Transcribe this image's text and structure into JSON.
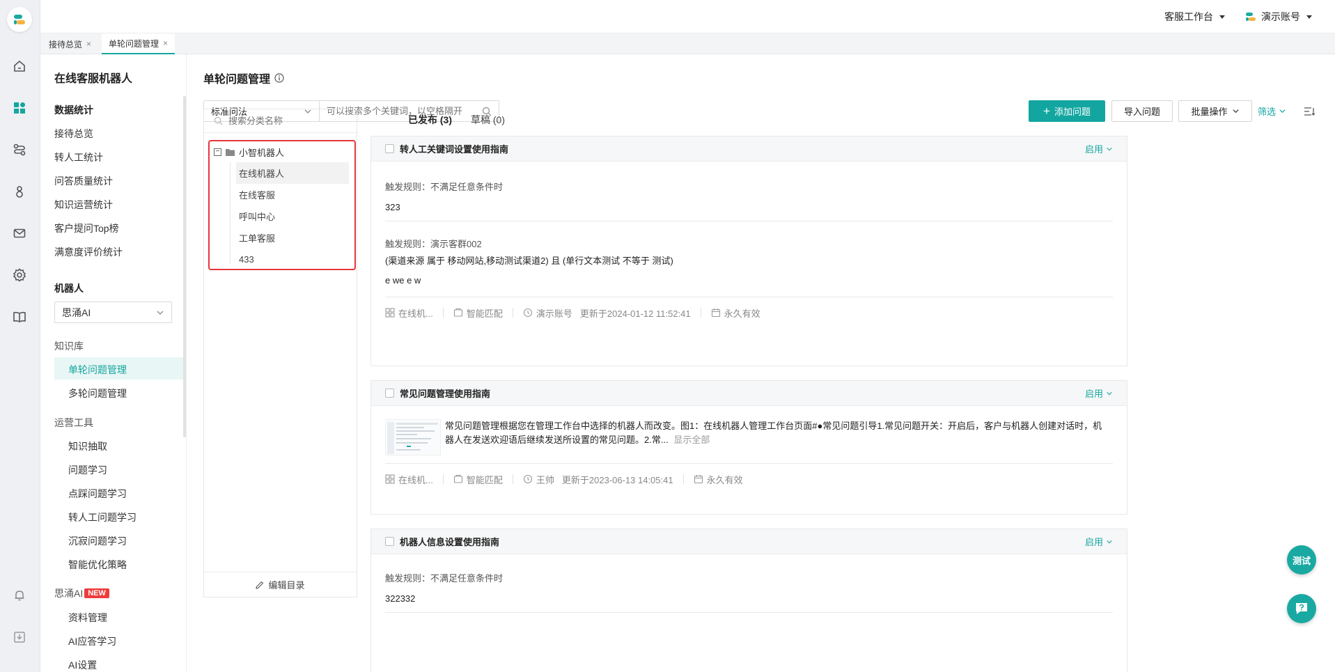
{
  "topbar": {
    "workspace": "客服工作台",
    "account": "演示账号"
  },
  "tabs": [
    {
      "label": "接待总览",
      "close": "×"
    },
    {
      "label": "单轮问题管理",
      "close": "×"
    }
  ],
  "nav": {
    "title": "在线客服机器人",
    "stats_heading": "数据统计",
    "stats_items": [
      "接待总览",
      "转人工统计",
      "问答质量统计",
      "知识运营统计",
      "客户提问Top榜",
      "满意度评价统计"
    ],
    "robot_heading": "机器人",
    "robot_select": "思涌AI",
    "kb_group": "知识库",
    "kb_items": [
      "单轮问题管理",
      "多轮问题管理"
    ],
    "ops_group": "运营工具",
    "ops_items": [
      "知识抽取",
      "问题学习",
      "点踩问题学习",
      "转人工问题学习",
      "沉寂问题学习",
      "智能优化策略"
    ],
    "ai_group": "思涌AI",
    "ai_badge": "NEW",
    "ai_items": [
      "资料管理",
      "AI应答学习",
      "AI设置"
    ]
  },
  "main": {
    "title": "单轮问题管理",
    "filter_select": "标准问法",
    "search_placeholder": "可以搜索多个关键词，以空格隔开",
    "buttons": {
      "add": "添加问题",
      "import": "导入问题",
      "batch": "批量操作",
      "filter": "筛选"
    },
    "category": {
      "search_placeholder": "搜索分类名称",
      "root": "小智机器人",
      "toggle": "−",
      "children": [
        "在线机器人",
        "在线客服",
        "呼叫中心",
        "工单客服",
        "433"
      ],
      "footer": "编辑目录"
    },
    "status_tabs": [
      "已发布 (3)",
      "草稿 (0)"
    ],
    "questions": [
      {
        "title": "转人工关键词设置使用指南",
        "status": "启用",
        "rule1_label": "触发规则：不满足任意条件时",
        "rule1_answer": "323",
        "rule2_label": "触发规则：演示客群002",
        "rule2_condition": "(渠道来源 属于 移动网站,移动测试渠道2) 且 (单行文本测试 不等于 测试)",
        "rule2_answer": "e we e w",
        "meta": {
          "channel": "在线机...",
          "match": "智能匹配",
          "author": "演示账号",
          "updated": "更新于2024-01-12 11:52:41",
          "validity": "永久有效"
        }
      },
      {
        "title": "常见问题管理使用指南",
        "status": "启用",
        "content": "常见问题管理根据您在管理工作台中选择的机器人而改变。图1：在线机器人管理工作台页面#●常见问题引导1.常见问题开关：开启后，客户与机器人创建对话时，机器人在发送欢迎语后继续发送所设置的常见问题。2.常...",
        "show_all": "显示全部",
        "meta": {
          "channel": "在线机...",
          "match": "智能匹配",
          "author": "王帅",
          "updated": "更新于2023-06-13 14:05:41",
          "validity": "永久有效"
        }
      },
      {
        "title": "机器人信息设置使用指南",
        "status": "启用",
        "rule1_label": "触发规则：不满足任意条件时",
        "rule1_answer": "322332"
      }
    ],
    "test_button": "测试"
  },
  "colors": {
    "accent": "#14a6a0",
    "highlight": "#e8353b",
    "badge": "#ef3b3b"
  }
}
